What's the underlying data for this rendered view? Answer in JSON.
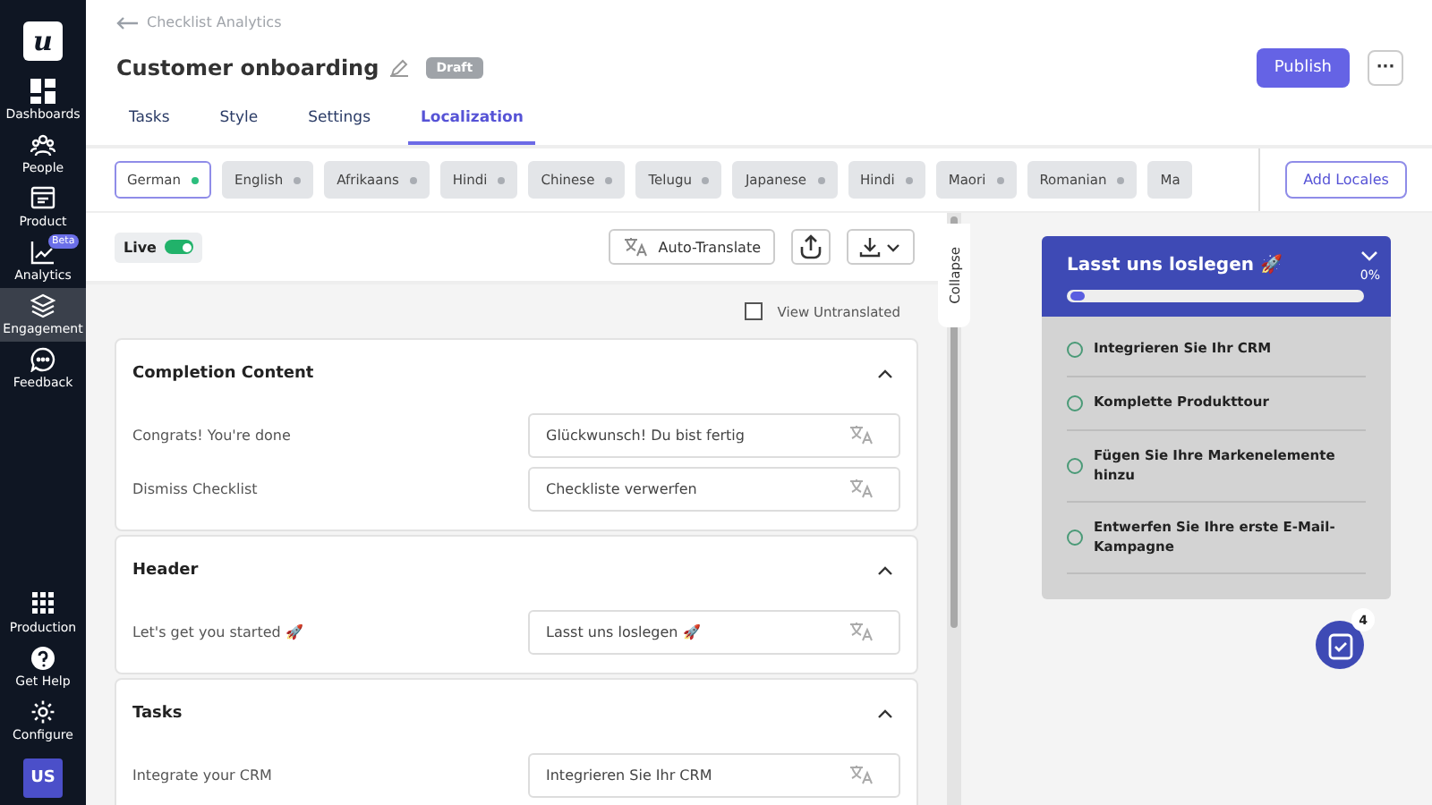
{
  "sidebar": {
    "logo": "u",
    "items": [
      {
        "label": "Dashboards",
        "selected": false
      },
      {
        "label": "People",
        "selected": false
      },
      {
        "label": "Product",
        "selected": false
      },
      {
        "label": "Analytics",
        "selected": false,
        "badge": "Beta"
      },
      {
        "label": "Engagement",
        "selected": true
      },
      {
        "label": "Feedback",
        "selected": false
      }
    ],
    "bottom_items": [
      {
        "label": "Production"
      },
      {
        "label": "Get Help"
      },
      {
        "label": "Configure"
      }
    ],
    "avatar": "US"
  },
  "breadcrumb": "Checklist Analytics",
  "title": "Customer onboarding",
  "status": "Draft",
  "actions": {
    "publish": "Publish",
    "more": "···"
  },
  "tabs": [
    {
      "label": "Tasks",
      "selected": false
    },
    {
      "label": "Style",
      "selected": false
    },
    {
      "label": "Settings",
      "selected": false
    },
    {
      "label": "Localization",
      "selected": true
    }
  ],
  "locales": [
    {
      "label": "German",
      "selected": true,
      "color": "#2dbe7e"
    },
    {
      "label": "English",
      "selected": false,
      "color": "#a9adb3"
    },
    {
      "label": "Afrikaans",
      "selected": false,
      "color": "#a9adb3"
    },
    {
      "label": "Hindi",
      "selected": false,
      "color": "#a9adb3"
    },
    {
      "label": "Chinese",
      "selected": false,
      "color": "#a9adb3"
    },
    {
      "label": "Telugu",
      "selected": false,
      "color": "#a9adb3"
    },
    {
      "label": "Japanese",
      "selected": false,
      "color": "#a9adb3"
    },
    {
      "label": "Hindi",
      "selected": false,
      "color": "#a9adb3"
    },
    {
      "label": "Maori",
      "selected": false,
      "color": "#a9adb3"
    },
    {
      "label": "Romanian",
      "selected": false,
      "color": "#a9adb3"
    },
    {
      "label": "Ma",
      "selected": false
    }
  ],
  "add_locales": "Add Locales",
  "toolbar": {
    "live_label": "Live",
    "live": true,
    "auto_translate": "Auto-Translate"
  },
  "view_untranslated": {
    "label": "View Untranslated",
    "checked": false
  },
  "sections": [
    {
      "title": "Completion Content",
      "expanded": true,
      "rows": [
        {
          "source": "Congrats! You're done",
          "translation": "Glückwunsch! Du bist fertig"
        },
        {
          "source": "Dismiss Checklist",
          "translation": "Checkliste verwerfen"
        }
      ]
    },
    {
      "title": "Header",
      "expanded": true,
      "rows": [
        {
          "source": "Let's get you started 🚀",
          "translation": "Lasst uns loslegen 🚀"
        }
      ]
    },
    {
      "title": "Tasks",
      "expanded": true,
      "rows": [
        {
          "source": "Integrate your CRM",
          "translation": "Integrieren Sie Ihr CRM"
        }
      ]
    }
  ],
  "collapse": "Collapse",
  "preview": {
    "title": "Lasst uns loslegen 🚀",
    "percent": "0%",
    "level": 0,
    "tasks": [
      {
        "label": "Integrieren Sie Ihr CRM",
        "checked": false
      },
      {
        "label": "Komplette Produkttour",
        "checked": false
      },
      {
        "label": "Fügen Sie Ihre Markenelemente hinzu",
        "checked": false
      },
      {
        "label": "Entwerfen Sie Ihre erste E-Mail-Kampagne",
        "checked": false
      }
    ],
    "launcher_count": "4"
  }
}
